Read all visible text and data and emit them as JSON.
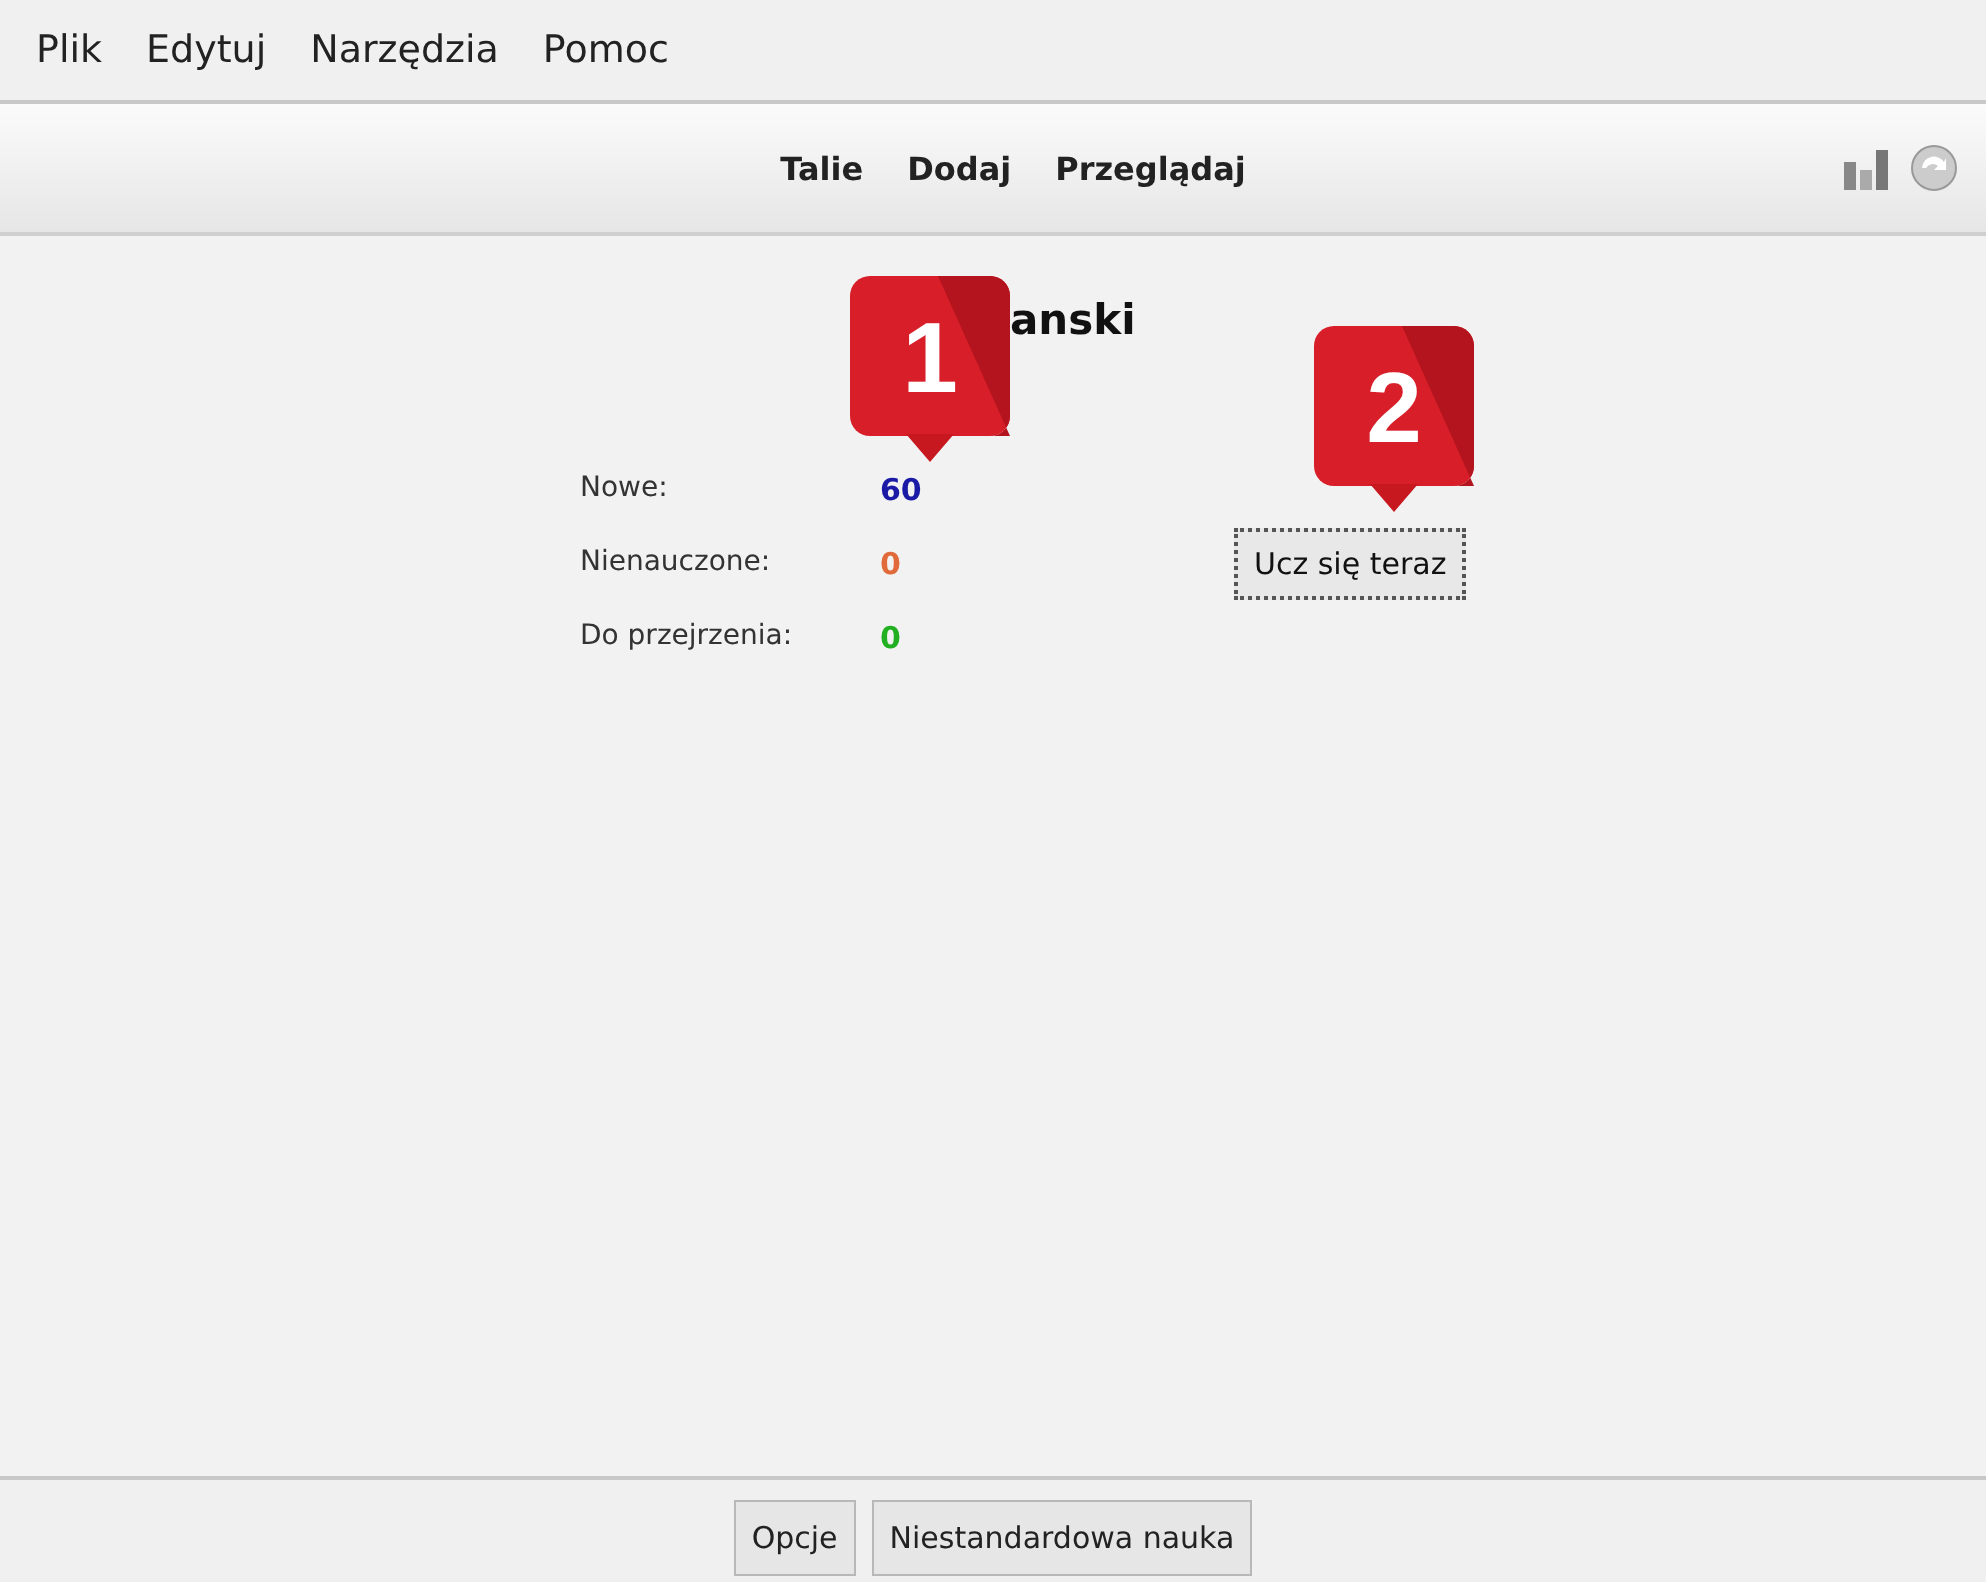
{
  "menu": [
    "Plik",
    "Edytuj",
    "Narzędzia",
    "Pomoc"
  ],
  "toolbar": {
    "links": [
      "Talie",
      "Dodaj",
      "Przeglądaj"
    ]
  },
  "deck": {
    "title": "anski",
    "stats": [
      {
        "label": "Nowe:",
        "value": "60",
        "color": "#1a1aa6"
      },
      {
        "label": "Nienauczone:",
        "value": "0",
        "color": "#e06a3a"
      },
      {
        "label": "Do przejrzenia:",
        "value": "0",
        "color": "#22b022"
      }
    ],
    "study_button": "Ucz się teraz"
  },
  "callouts": [
    "1",
    "2"
  ],
  "bottom_buttons": [
    "Opcje",
    "Niestandardowa nauka"
  ]
}
